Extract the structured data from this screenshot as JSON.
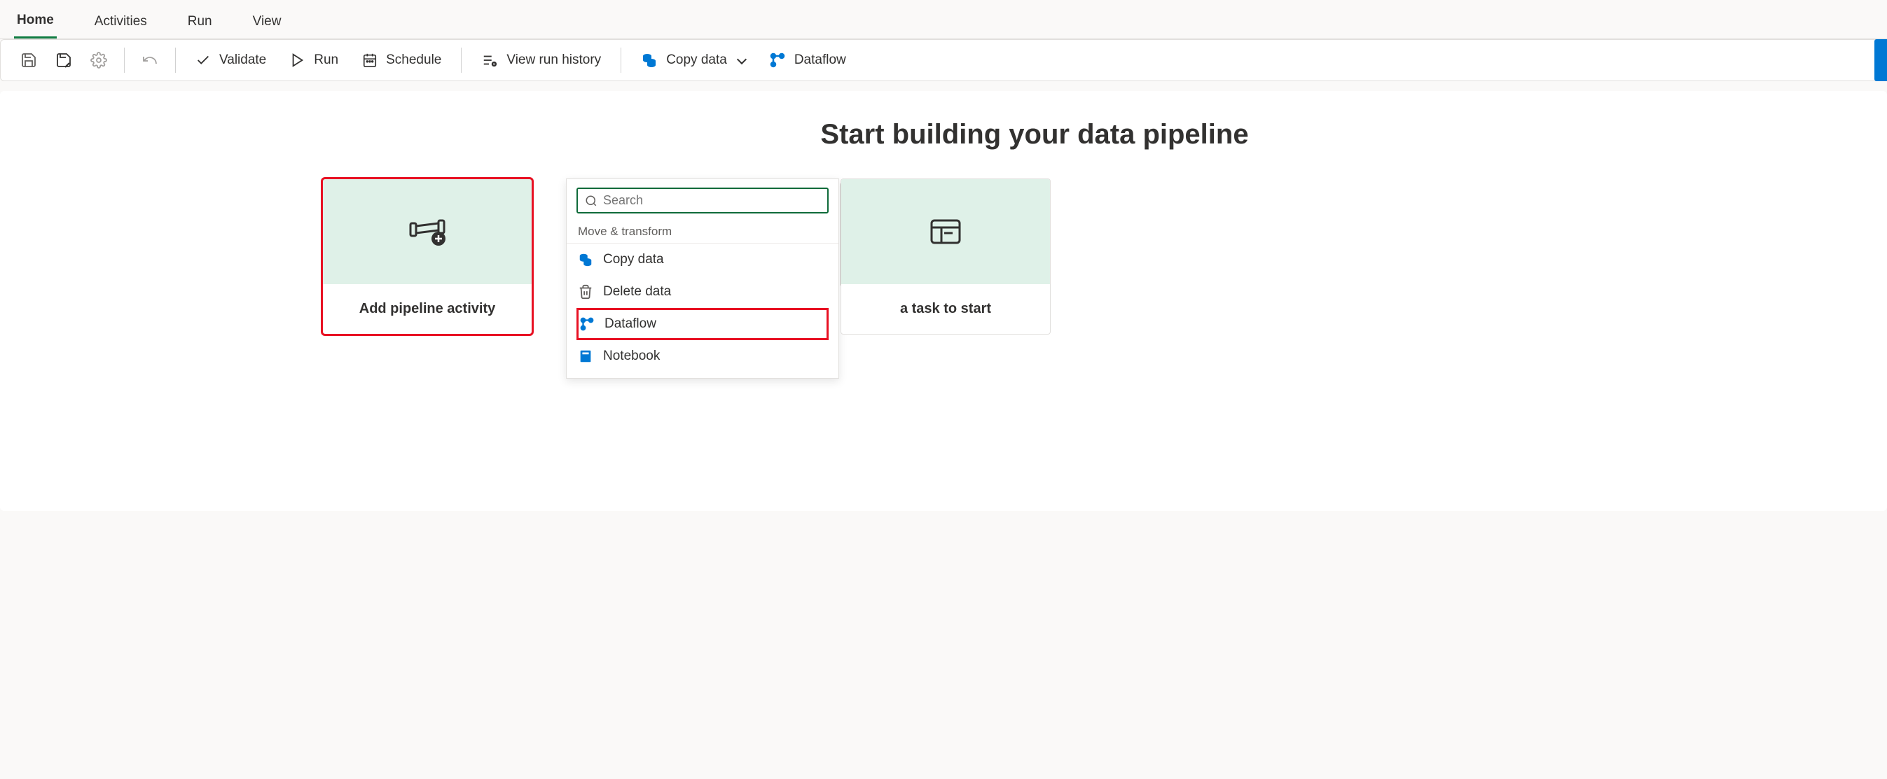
{
  "tabs": {
    "home": "Home",
    "activities": "Activities",
    "run": "Run",
    "view": "View"
  },
  "ribbon": {
    "validate": "Validate",
    "run": "Run",
    "schedule": "Schedule",
    "view_run_history": "View run history",
    "copy_data": "Copy data",
    "dataflow": "Dataflow"
  },
  "main": {
    "heading": "Start building your data pipeline",
    "add_pipeline_activity": "Add pipeline activity",
    "task_to_start": "a task to start"
  },
  "search": {
    "placeholder": "Search"
  },
  "dropdown": {
    "group": "Move & transform",
    "copy_data": "Copy data",
    "delete_data": "Delete data",
    "dataflow": "Dataflow",
    "notebook": "Notebook"
  }
}
